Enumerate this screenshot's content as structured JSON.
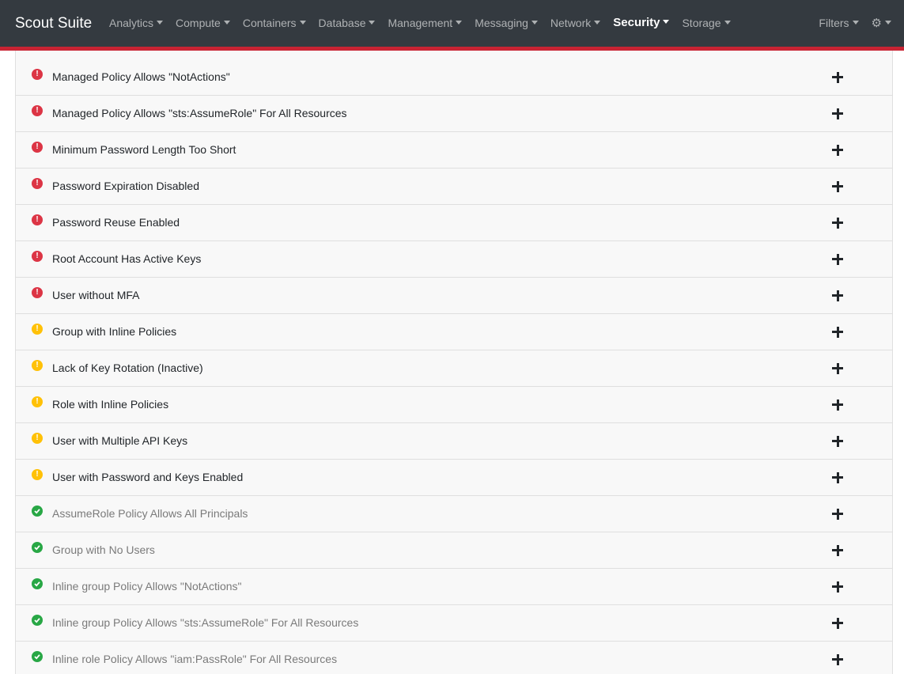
{
  "navbar": {
    "brand": "Scout Suite",
    "menu": [
      {
        "label": "Analytics"
      },
      {
        "label": "Compute"
      },
      {
        "label": "Containers"
      },
      {
        "label": "Database"
      },
      {
        "label": "Management"
      },
      {
        "label": "Messaging"
      },
      {
        "label": "Network"
      },
      {
        "label": "Security"
      },
      {
        "label": "Storage"
      }
    ],
    "active_menu": "Security",
    "filters_label": "Filters",
    "settings_icon": "gear-icon"
  },
  "colors": {
    "navbar_bg": "#343a40",
    "accent_border": "#c82333",
    "danger": "#dc3545",
    "warning": "#ffc107",
    "good": "#28a745"
  },
  "findings": [
    {
      "label": "Managed Policy Allows \"NotActions\"",
      "level": "danger"
    },
    {
      "label": "Managed Policy Allows \"sts:AssumeRole\" For All Resources",
      "level": "danger"
    },
    {
      "label": "Minimum Password Length Too Short",
      "level": "danger"
    },
    {
      "label": "Password Expiration Disabled",
      "level": "danger"
    },
    {
      "label": "Password Reuse Enabled",
      "level": "danger"
    },
    {
      "label": "Root Account Has Active Keys",
      "level": "danger"
    },
    {
      "label": "User without MFA",
      "level": "danger"
    },
    {
      "label": "Group with Inline Policies",
      "level": "warning"
    },
    {
      "label": "Lack of Key Rotation (Inactive)",
      "level": "warning"
    },
    {
      "label": "Role with Inline Policies",
      "level": "warning"
    },
    {
      "label": "User with Multiple API Keys",
      "level": "warning"
    },
    {
      "label": "User with Password and Keys Enabled",
      "level": "warning"
    },
    {
      "label": "AssumeRole Policy Allows All Principals",
      "level": "good"
    },
    {
      "label": "Group with No Users",
      "level": "good"
    },
    {
      "label": "Inline group Policy Allows \"NotActions\"",
      "level": "good"
    },
    {
      "label": "Inline group Policy Allows \"sts:AssumeRole\" For All Resources",
      "level": "good"
    },
    {
      "label": "Inline role Policy Allows \"iam:PassRole\" For All Resources",
      "level": "good"
    }
  ]
}
